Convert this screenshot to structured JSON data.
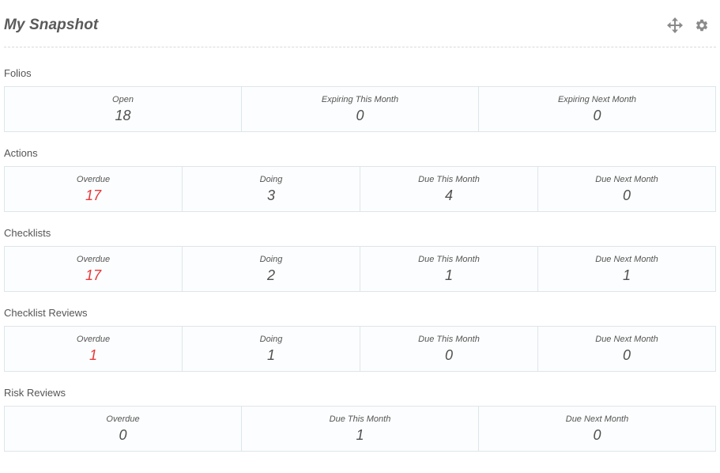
{
  "widget": {
    "title": "My Snapshot",
    "tools": [
      {
        "icon": "move-icon"
      },
      {
        "icon": "gear-icon"
      }
    ]
  },
  "colors": {
    "danger": "#e8373a",
    "text": "#555555",
    "border": "#dde6ea"
  },
  "sections": [
    {
      "title": "Folios",
      "cells": [
        {
          "label": "Open",
          "value": "18"
        },
        {
          "label": "Expiring This Month",
          "value": "0"
        },
        {
          "label": "Expiring Next Month",
          "value": "0"
        }
      ]
    },
    {
      "title": "Actions",
      "cells": [
        {
          "label": "Overdue",
          "value": "17",
          "alert": true
        },
        {
          "label": "Doing",
          "value": "3"
        },
        {
          "label": "Due This Month",
          "value": "4"
        },
        {
          "label": "Due Next Month",
          "value": "0"
        }
      ]
    },
    {
      "title": "Checklists",
      "cells": [
        {
          "label": "Overdue",
          "value": "17",
          "alert": true
        },
        {
          "label": "Doing",
          "value": "2"
        },
        {
          "label": "Due This Month",
          "value": "1"
        },
        {
          "label": "Due Next Month",
          "value": "1"
        }
      ]
    },
    {
      "title": "Checklist Reviews",
      "cells": [
        {
          "label": "Overdue",
          "value": "1",
          "alert": true
        },
        {
          "label": "Doing",
          "value": "1"
        },
        {
          "label": "Due This Month",
          "value": "0"
        },
        {
          "label": "Due Next Month",
          "value": "0"
        }
      ]
    },
    {
      "title": "Risk Reviews",
      "cells": [
        {
          "label": "Overdue",
          "value": "0"
        },
        {
          "label": "Due This Month",
          "value": "1"
        },
        {
          "label": "Due Next Month",
          "value": "0"
        }
      ]
    }
  ]
}
